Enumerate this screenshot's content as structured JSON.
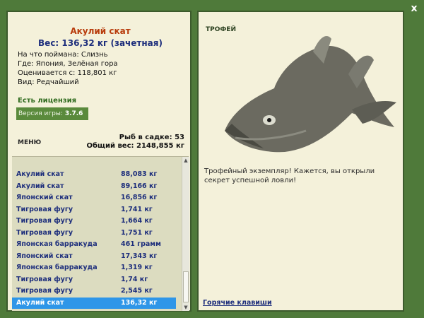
{
  "close_label": "x",
  "catch": {
    "name": "Акулий скат",
    "weight_line": "Вес: 136,32 кг (зачетная)",
    "bait": "На что поймана: Слизнь",
    "location": "Где: Япония, Зелёная гора",
    "value": "Оценивается с: 118,801 кг",
    "rarity": "Вид: Редчайший"
  },
  "license": "Есть лицензия",
  "version": {
    "label": "Версия игры:",
    "value": "3.7.6"
  },
  "menu_label": "МЕНЮ",
  "stats": {
    "fish_count": "Рыб в садке: 53",
    "total_weight": "Общий вес: 2148,855 кг"
  },
  "catch_list": [
    {
      "name": "Акулий скат",
      "weight": "88,083 кг"
    },
    {
      "name": "Акулий скат",
      "weight": "89,166 кг"
    },
    {
      "name": "Японский скат",
      "weight": "16,856 кг"
    },
    {
      "name": "Тигровая фугу",
      "weight": "1,741 кг"
    },
    {
      "name": "Тигровая фугу",
      "weight": "1,664 кг"
    },
    {
      "name": "Тигровая фугу",
      "weight": "1,751 кг"
    },
    {
      "name": "Японская барракуда",
      "weight": "461 грамм"
    },
    {
      "name": "Японский скат",
      "weight": "17,343 кг"
    },
    {
      "name": "Японская барракуда",
      "weight": "1,319 кг"
    },
    {
      "name": "Тигровая фугу",
      "weight": "1,74 кг"
    },
    {
      "name": "Тигровая фугу",
      "weight": "2,545 кг"
    },
    {
      "name": "Акулий скат",
      "weight": "136,32 кг"
    }
  ],
  "selected_index": 11,
  "trophy": {
    "label": "ТРОФЕЙ",
    "text": "Трофейный экземпляр! Кажется, вы открыли секрет успешной ловли!"
  },
  "hotkeys_label": "Горячие клавиши",
  "colors": {
    "background": "#4f7a3a",
    "panel": "#f4f1da",
    "selection": "#2e96e8",
    "fish_name": "#b83c0c",
    "list_text": "#1d2e7c"
  }
}
